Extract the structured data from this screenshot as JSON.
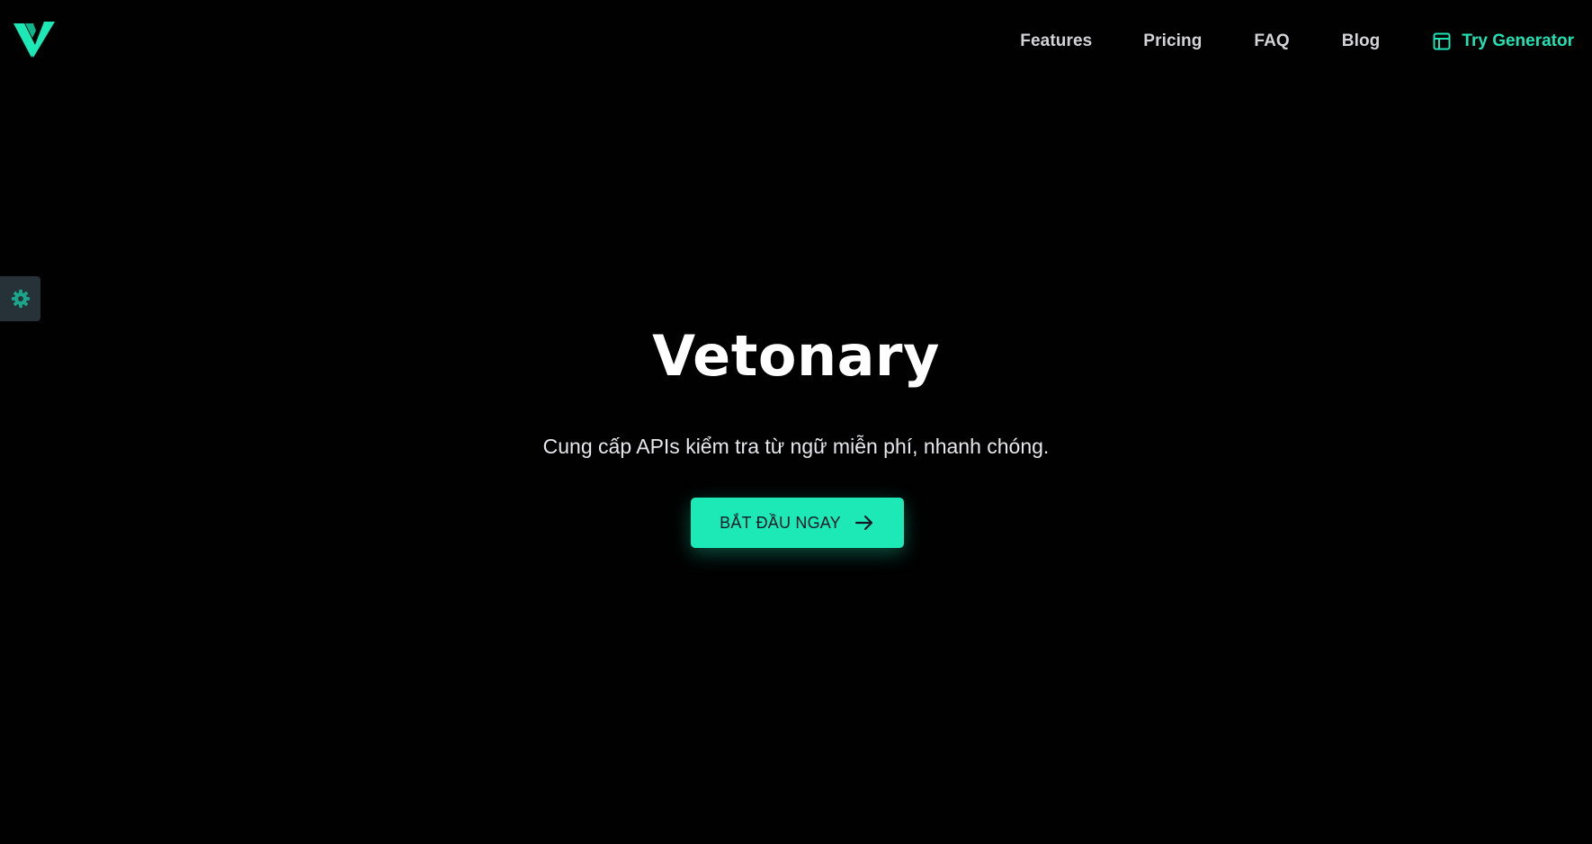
{
  "brand": {
    "logo_icon": "vetonary-v-logo-icon",
    "accent_color": "#1de9b6"
  },
  "nav": {
    "items": [
      {
        "label": "Features"
      },
      {
        "label": "Pricing"
      },
      {
        "label": "FAQ"
      },
      {
        "label": "Blog"
      }
    ],
    "cta": {
      "label": "Try Generator",
      "icon": "layout-panel-icon"
    }
  },
  "settings": {
    "icon": "gear-icon",
    "background": "#263238"
  },
  "hero": {
    "title": "Vetonary",
    "subtitle": "Cung cấp APIs kiểm tra từ ngữ miễn phí, nhanh chóng.",
    "button": {
      "label": "BẮT ĐẦU NGAY",
      "icon": "arrow-right-icon"
    }
  }
}
